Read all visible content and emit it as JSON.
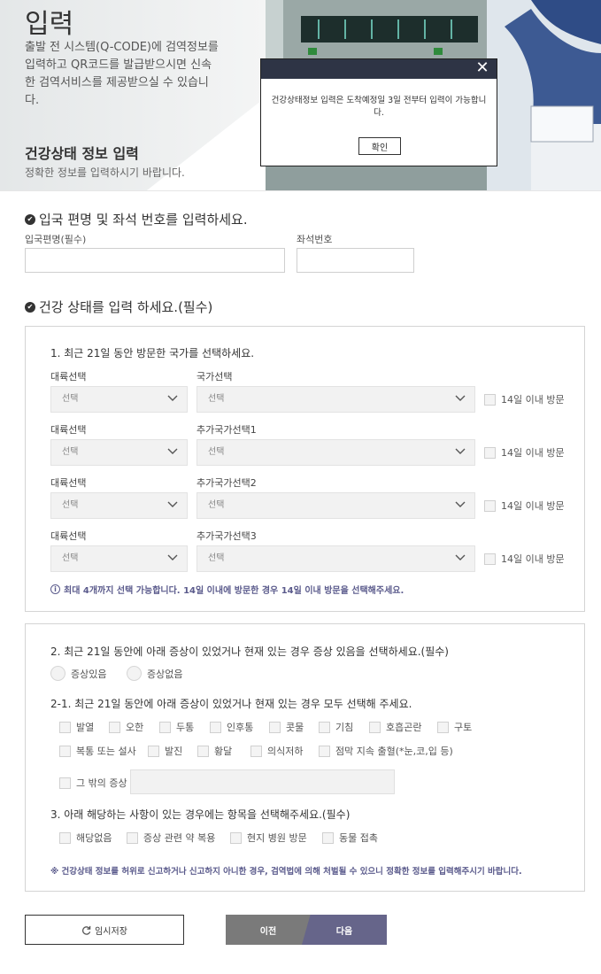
{
  "header": {
    "title": "입력",
    "intro": "출발 전 시스템(Q-CODE)에 검역정보를 입력하고 QR코드를 발급받으시면 신속한 검역서비스를 제공받으실 수 있습니다.",
    "section_title": "건강상태 정보 입력",
    "section_sub": "정확한 정보를 입력하시기 바랍니다."
  },
  "modal": {
    "message": "건강상태정보 입력은 도착예정일 3일 전부터 입력이 가능합니다.",
    "ok_label": "확인"
  },
  "flight": {
    "title": "입국 편명 및 좌석 번호를 입력하세요.",
    "flight_label": "입국편명(필수)",
    "flight_value": "",
    "seat_label": "좌석번호",
    "seat_value": ""
  },
  "health": {
    "title": "건강 상태를 입력 하세요.(필수)"
  },
  "countries": {
    "question": "1. 최근 21일 동안 방문한 국가를 선택하세요.",
    "rows": [
      {
        "continent_label": "대륙선택",
        "continent_value": "선택",
        "country_label": "국가선택",
        "country_value": "선택",
        "check_label": "14일 이내 방문"
      },
      {
        "continent_label": "대륙선택",
        "continent_value": "선택",
        "country_label": "추가국가선택1",
        "country_value": "선택",
        "check_label": "14일 이내 방문"
      },
      {
        "continent_label": "대륙선택",
        "continent_value": "선택",
        "country_label": "추가국가선택2",
        "country_value": "선택",
        "check_label": "14일 이내 방문"
      },
      {
        "continent_label": "대륙선택",
        "continent_value": "선택",
        "country_label": "추가국가선택3",
        "country_value": "선택",
        "check_label": "14일 이내 방문"
      }
    ],
    "note": "최대 4개까지 선택 가능합니다. 14일 이내에 방문한 경우 14일 이내 방문을 선택해주세요."
  },
  "symptoms": {
    "question": "2. 최근 21일 동안에 아래 증상이 있었거나 현재 있는 경우 증상 있음을 선택하세요.(필수)",
    "radio_yes": "증상있음",
    "radio_no": "증상없음",
    "sub_question": "2-1. 최근 21일 동안에 아래 증상이 있었거나 현재 있는 경우 모두 선택해 주세요.",
    "row1": [
      "발열",
      "오한",
      "두통",
      "인후통",
      "콧물",
      "기침",
      "호흡곤란",
      "구토"
    ],
    "row2": [
      "복통 또는 설사",
      "발진",
      "황달",
      "의식저하",
      "점막 지속 출혈(*눈,코,입 등)"
    ],
    "other_label": "그 밖의 증상",
    "other_value": "",
    "q3": "3. 아래 해당하는 사항이 있는 경우에는 항목을 선택해주세요.(필수)",
    "row3": [
      "해당없음",
      "증상 관련 약 복용",
      "현지 병원 방문",
      "동물 접촉"
    ],
    "warning": "※ 건강상태 정보를 허위로 신고하거나 신고하지 아니한 경우, 검역법에 의해 처벌될 수 있으니 정확한 정보를 입력해주시기 바랍니다."
  },
  "buttons": {
    "save": "임시저장",
    "prev": "이전",
    "next": "다음"
  },
  "colors": {
    "accent": "#66658a",
    "modal_header": "#2e3445",
    "note": "#5b5b8c"
  }
}
